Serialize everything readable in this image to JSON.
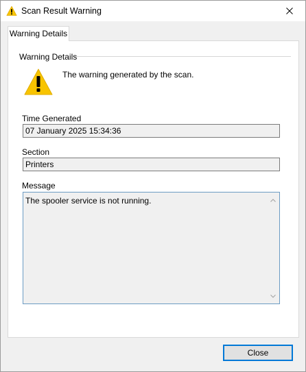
{
  "window": {
    "title": "Scan Result Warning"
  },
  "tabs": [
    {
      "label": "Warning Details",
      "selected": true
    }
  ],
  "panel": {
    "group_label": "Warning Details",
    "description": "The warning generated by the scan.",
    "fields": {
      "time_generated": {
        "label": "Time Generated",
        "value": "07 January 2025 15:34:36"
      },
      "section": {
        "label": "Section",
        "value": "Printers"
      },
      "message": {
        "label": "Message",
        "value": "The spooler service is not running."
      }
    }
  },
  "buttons": {
    "close_label": "Close"
  },
  "icons": {
    "title_icon": "warning-triangle-icon",
    "large_icon": "warning-triangle-icon",
    "close": "close-icon"
  },
  "colors": {
    "warning_yellow": "#f8c400",
    "focus_blue": "#0078d7"
  }
}
